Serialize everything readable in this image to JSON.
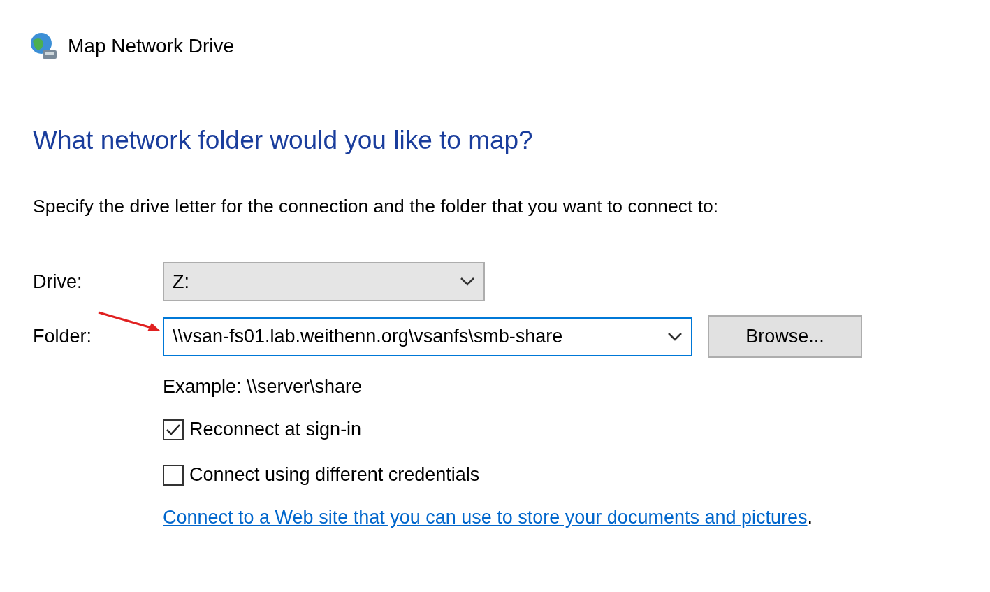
{
  "window": {
    "title": "Map Network Drive"
  },
  "heading": "What network folder would you like to map?",
  "instruction": "Specify the drive letter for the connection and the folder that you want to connect to:",
  "drive": {
    "label": "Drive:",
    "value": "Z:"
  },
  "folder": {
    "label": "Folder:",
    "value": "\\\\vsan-fs01.lab.weithenn.org\\vsanfs\\smb-share",
    "focused": true
  },
  "browse_button": "Browse...",
  "example": "Example: \\\\server\\share",
  "options": [
    {
      "label": "Reconnect at sign-in",
      "checked": true
    },
    {
      "label": "Connect using different credentials",
      "checked": false
    }
  ],
  "link": {
    "text": "Connect to a Web site that you can use to store your documents and pictures",
    "suffix": "."
  }
}
